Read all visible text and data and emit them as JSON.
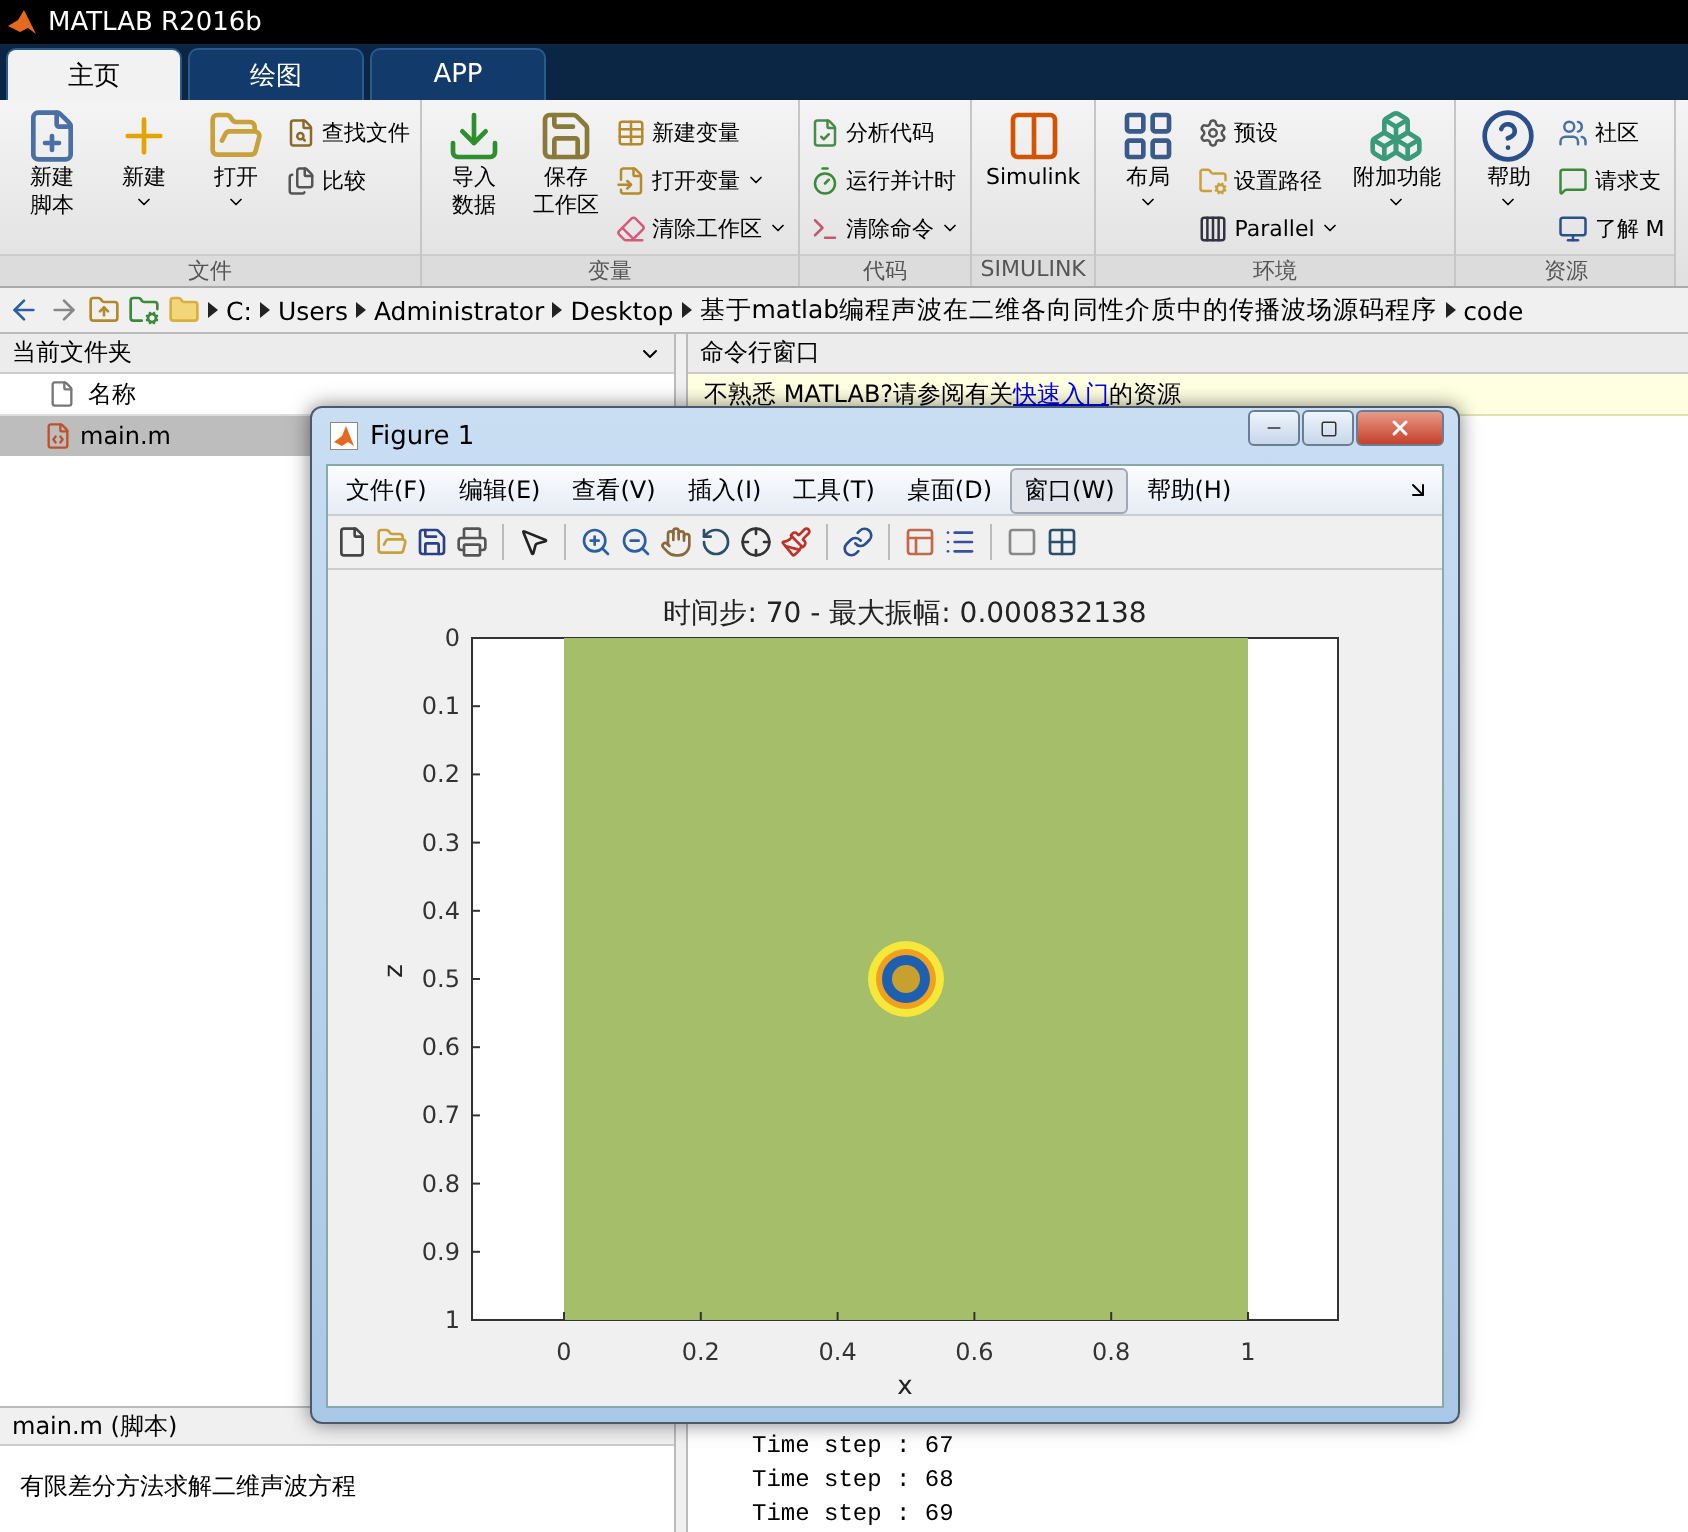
{
  "window": {
    "title": "MATLAB R2016b"
  },
  "tabs": [
    {
      "label": "主页",
      "selected": true
    },
    {
      "label": "绘图",
      "selected": false
    },
    {
      "label": "APP",
      "selected": false
    }
  ],
  "ribbon": [
    {
      "label": "文件",
      "items": [
        {
          "kind": "large",
          "label": [
            "新建",
            "脚本"
          ],
          "caret": false
        },
        {
          "kind": "large",
          "label": "新建",
          "caret": true
        },
        {
          "kind": "large",
          "label": "打开",
          "caret": true
        },
        {
          "kind": "small",
          "label": "查找文件",
          "caret": false
        },
        {
          "kind": "small",
          "label": "比较",
          "caret": false
        }
      ]
    },
    {
      "label": "变量",
      "items": [
        {
          "kind": "large",
          "label": [
            "导入",
            "数据"
          ],
          "caret": false
        },
        {
          "kind": "large",
          "label": [
            "保存",
            "工作区"
          ],
          "caret": false
        },
        {
          "kind": "small",
          "label": "新建变量",
          "caret": false
        },
        {
          "kind": "small",
          "label": "打开变量",
          "caret": true
        },
        {
          "kind": "small",
          "label": "清除工作区",
          "caret": true
        }
      ]
    },
    {
      "label": "代码",
      "items": [
        {
          "kind": "small",
          "label": "分析代码",
          "caret": false
        },
        {
          "kind": "small",
          "label": "运行并计时",
          "caret": false
        },
        {
          "kind": "small",
          "label": "清除命令",
          "caret": true
        }
      ]
    },
    {
      "label": "SIMULINK",
      "items": [
        {
          "kind": "large",
          "label": "Simulink",
          "caret": false
        }
      ]
    },
    {
      "label": "环境",
      "items": [
        {
          "kind": "large",
          "label": "布局",
          "caret": true
        },
        {
          "kind": "small",
          "label": "预设",
          "caret": false
        },
        {
          "kind": "small",
          "label": "设置路径",
          "caret": false
        },
        {
          "kind": "small",
          "label": "Parallel",
          "caret": true
        },
        {
          "kind": "large",
          "label": "附加功能",
          "caret": true
        }
      ]
    },
    {
      "label": "资源",
      "items": [
        {
          "kind": "large",
          "label": "帮助",
          "caret": true
        },
        {
          "kind": "small",
          "label": "社区",
          "caret": false
        },
        {
          "kind": "small",
          "label": "请求支",
          "caret": false
        },
        {
          "kind": "small",
          "label": "了解 M",
          "caret": false
        }
      ]
    }
  ],
  "address_path": [
    "C:",
    "Users",
    "Administrator",
    "Desktop",
    "基于matlab编程声波在二维各向同性介质中的传播波场源码程序",
    "code"
  ],
  "current_folder": {
    "title": "当前文件夹",
    "column": "名称",
    "files": [
      {
        "name": "main.m",
        "selected": true
      }
    ],
    "details_title": "main.m  (脚本)",
    "details_text": "有限差分方法求解二维声波方程"
  },
  "command_window": {
    "title": "命令行窗口",
    "notice": "不熟悉 MATLAB?请参阅有关",
    "notice_link": "快速入门",
    "notice_end": "的资源",
    "lines": [
      "Time step : 67",
      "Time step : 68",
      "Time step : 69"
    ]
  },
  "figure": {
    "title": "Figure 1",
    "menu": [
      {
        "label": "文件(F)",
        "selected": false
      },
      {
        "label": "编辑(E)",
        "selected": false
      },
      {
        "label": "查看(V)",
        "selected": false
      },
      {
        "label": "插入(I)",
        "selected": false
      },
      {
        "label": "工具(T)",
        "selected": false
      },
      {
        "label": "桌面(D)",
        "selected": false
      },
      {
        "label": "窗口(W)",
        "selected": true
      },
      {
        "label": "帮助(H)",
        "selected": false
      }
    ],
    "plot": {
      "title": "时间步: 70 - 最大振幅: 0.000832138",
      "xlabel": "x",
      "ylabel": "z",
      "xticks": [
        "0",
        "0.2",
        "0.4",
        "0.6",
        "0.8",
        "1"
      ],
      "yticks": [
        "0",
        "0.1",
        "0.2",
        "0.3",
        "0.4",
        "0.5",
        "0.6",
        "0.7",
        "0.8",
        "0.9",
        "1"
      ]
    }
  }
}
